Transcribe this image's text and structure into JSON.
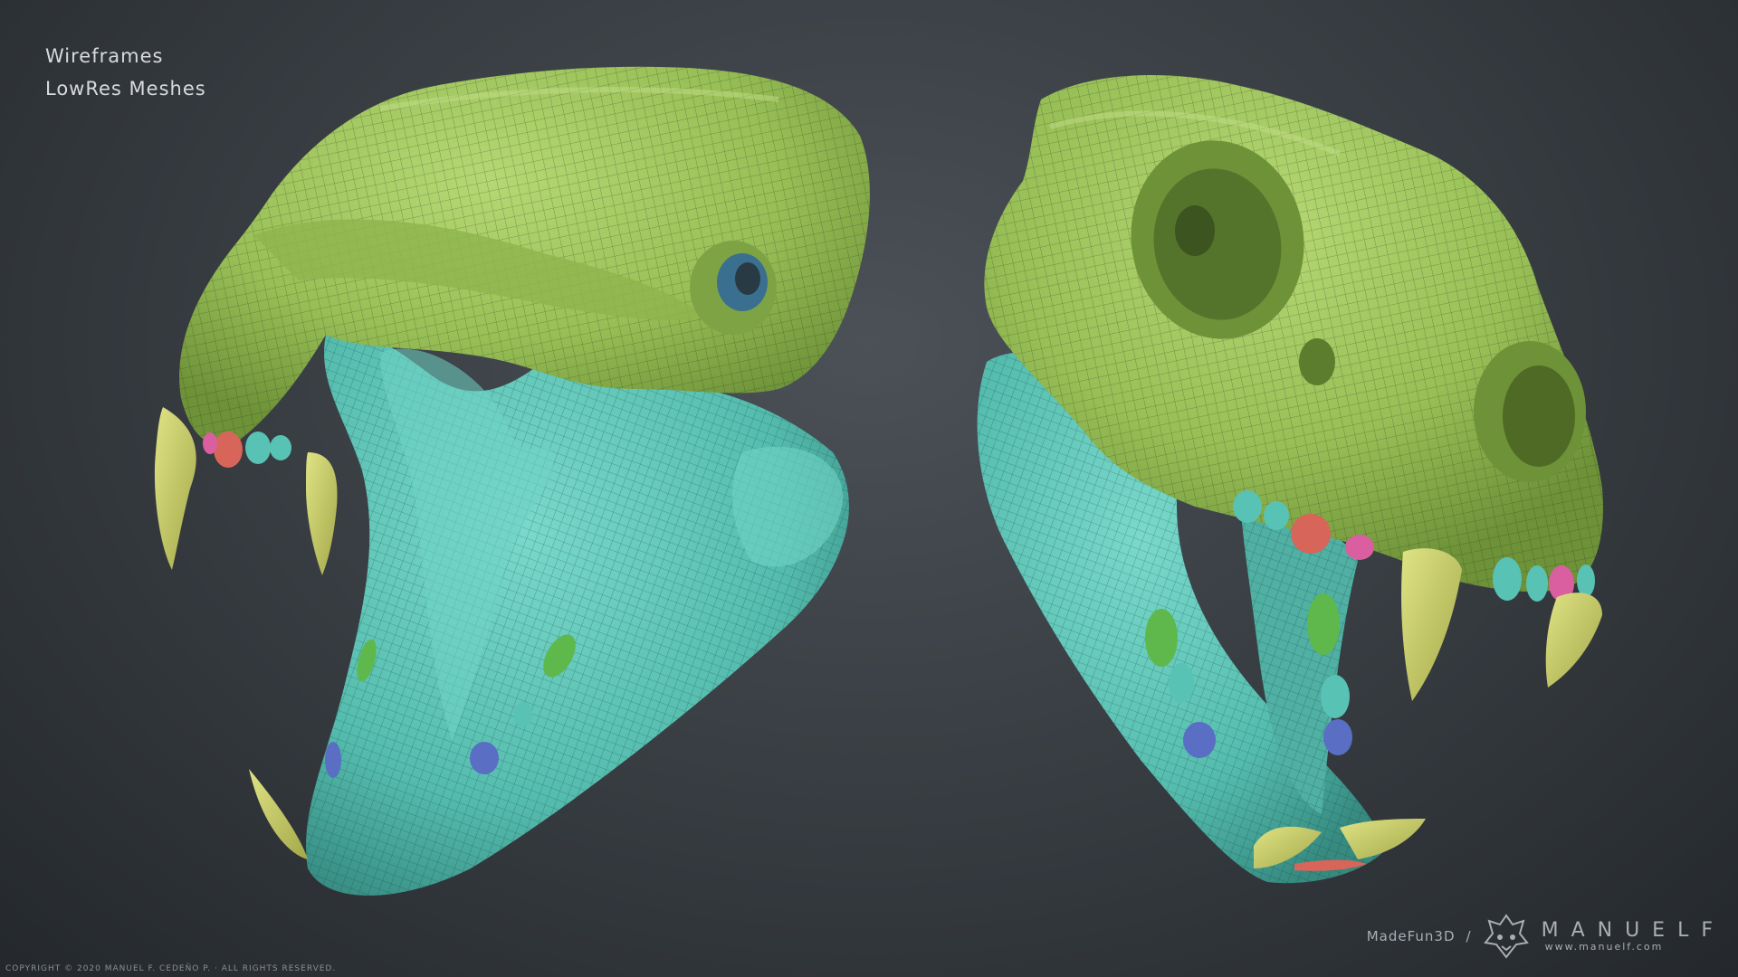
{
  "labels": {
    "wireframes": "Wireframes",
    "lowres": "LowRes Meshes"
  },
  "colors": {
    "skull": "#9cc25a",
    "skull_dark": "#7ea345",
    "mandible": "#58c2b4",
    "mandible_dark": "#3f9e92",
    "canine": "#c9cf6a",
    "tooth_red": "#d8655a",
    "tooth_pink": "#d95fa0",
    "tooth_blue": "#5a6ec4",
    "tooth_green": "#5fb84c",
    "wire": "#1f2d1c"
  },
  "copyright": "COPYRIGHT © 2020 MANUEL F. CEDEÑO P. · ALL RIGHTS RESERVED.",
  "brand": {
    "studio": "MadeFun3D",
    "separator": "/",
    "name": "MANUELF",
    "url": "www.manuelf.com"
  }
}
